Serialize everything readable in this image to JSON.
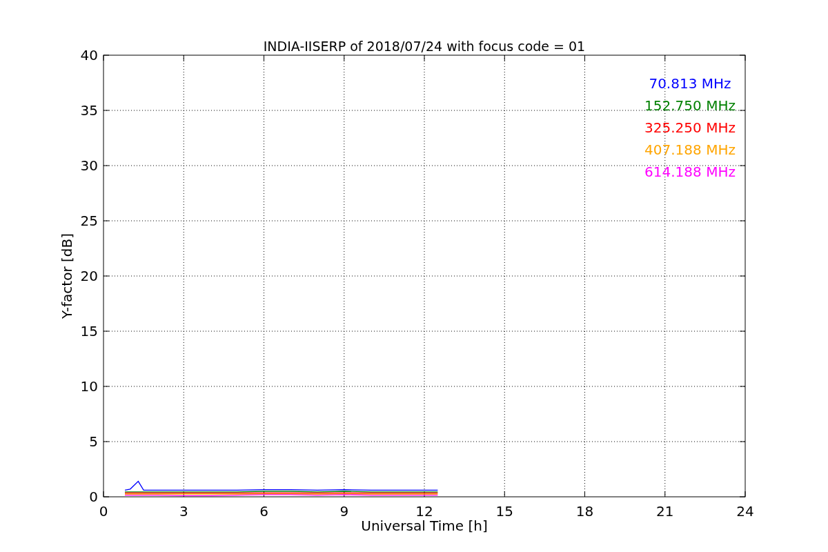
{
  "chart_data": {
    "type": "line",
    "title": "INDIA-IISERP of 2018/07/24 with focus code = 01",
    "xlabel": "Universal Time [h]",
    "ylabel": "Y-factor [dB]",
    "x": [
      0.8,
      1.0,
      1.3,
      1.5,
      2,
      3,
      4,
      5,
      6,
      7,
      8,
      9,
      10,
      11,
      12,
      12.5
    ],
    "series": [
      {
        "name": "70.813 MHz",
        "color": "#0000ff",
        "values": [
          0.6,
          0.7,
          1.4,
          0.6,
          0.6,
          0.6,
          0.6,
          0.6,
          0.65,
          0.65,
          0.6,
          0.65,
          0.6,
          0.6,
          0.6,
          0.6
        ]
      },
      {
        "name": "152.750 MHz",
        "color": "#008000",
        "values": [
          0.45,
          0.45,
          0.45,
          0.45,
          0.45,
          0.45,
          0.45,
          0.45,
          0.5,
          0.5,
          0.45,
          0.5,
          0.45,
          0.45,
          0.45,
          0.45
        ]
      },
      {
        "name": "325.250 MHz",
        "color": "#ff0000",
        "values": [
          0.35,
          0.35,
          0.35,
          0.35,
          0.35,
          0.35,
          0.35,
          0.35,
          0.35,
          0.35,
          0.35,
          0.35,
          0.35,
          0.35,
          0.35,
          0.35
        ]
      },
      {
        "name": "407.188 MHz",
        "color": "#ffa500",
        "values": [
          0.25,
          0.25,
          0.25,
          0.25,
          0.25,
          0.25,
          0.25,
          0.25,
          0.25,
          0.25,
          0.25,
          0.25,
          0.25,
          0.25,
          0.25,
          0.25
        ]
      },
      {
        "name": "614.188 MHz",
        "color": "#ff00ff",
        "values": [
          0.15,
          0.15,
          0.15,
          0.15,
          0.15,
          0.1,
          0.1,
          0.15,
          0.2,
          0.2,
          0.15,
          0.2,
          0.15,
          0.15,
          0.15,
          0.15
        ]
      }
    ],
    "grid": true,
    "xlim": [
      0,
      24
    ],
    "ylim": [
      0,
      40
    ],
    "xticks": [
      0,
      3,
      6,
      9,
      12,
      15,
      18,
      21,
      24
    ],
    "yticks": [
      0,
      5,
      10,
      15,
      20,
      25,
      30,
      35,
      40
    ]
  }
}
